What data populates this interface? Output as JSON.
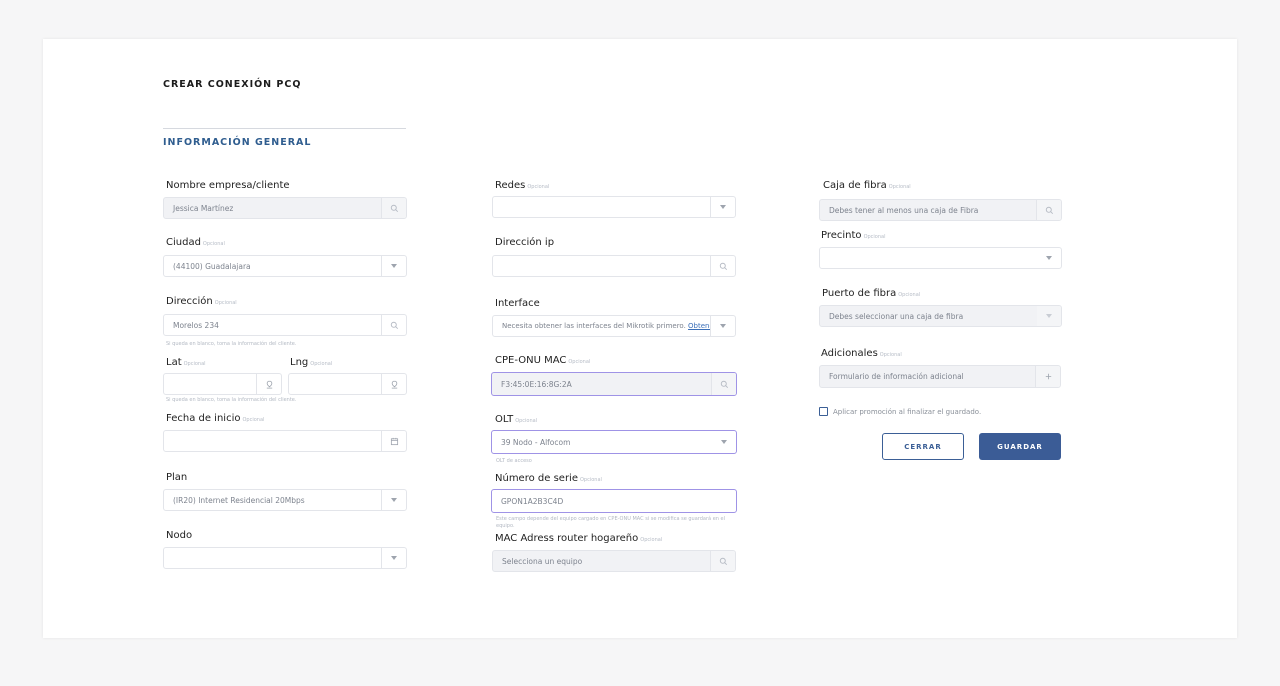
{
  "page": {
    "title": "CREAR CONEXIÓN PCQ",
    "section": "INFORMACIÓN GENERAL"
  },
  "optional_tag": "Opcional",
  "left": {
    "nombre": {
      "label": "Nombre empresa/cliente",
      "value": "Jessica Martínez"
    },
    "ciudad": {
      "label": "Ciudad",
      "value": "(44100) Guadalajara"
    },
    "direccion": {
      "label": "Dirección",
      "value": "Morelos 234",
      "help": "Si queda en blanco, toma la información del cliente."
    },
    "lat": {
      "label": "Lat",
      "value": ""
    },
    "lng": {
      "label": "Lng",
      "value": ""
    },
    "coords_help": "Si queda en blanco, toma la información del cliente.",
    "fecha": {
      "label": "Fecha de inicio",
      "value": ""
    },
    "plan": {
      "label": "Plan",
      "value": "(IR20) Internet Residencial 20Mbps"
    },
    "nodo": {
      "label": "Nodo",
      "value": ""
    }
  },
  "middle": {
    "redes": {
      "label": "Redes",
      "value": ""
    },
    "ip": {
      "label": "Dirección ip",
      "value": ""
    },
    "interface": {
      "label": "Interface",
      "value": "Necesita obtener las interfaces del Mikrotik primero.",
      "link": "Obtener"
    },
    "mac": {
      "label": "CPE-ONU MAC",
      "value": "F3:45:0E:16:8G:2A"
    },
    "olt": {
      "label": "OLT",
      "value": "39 Nodo - Alfocom",
      "help": "OLT de acceso"
    },
    "serie": {
      "label": "Número de serie",
      "value": "GPON1A2B3C4D",
      "help": "Este campo depende del equipo cargado en CPE-ONU MAC si se modifica se guardará en el equipo."
    },
    "router": {
      "label": "MAC Adress router hogareño",
      "placeholder": "Selecciona un equipo"
    }
  },
  "right": {
    "caja": {
      "label": "Caja de fibra",
      "placeholder": "Debes tener al menos una caja de Fibra"
    },
    "precinto": {
      "label": "Precinto",
      "value": ""
    },
    "puerto": {
      "label": "Puerto de fibra",
      "placeholder": "Debes seleccionar una caja de fibra"
    },
    "adicionales": {
      "label": "Adicionales",
      "placeholder": "Formulario de información adicional"
    },
    "promo_label": "Aplicar promoción al finalizar el guardado."
  },
  "buttons": {
    "cancel": "CERRAR",
    "save": "GUARDAR"
  },
  "colors": {
    "accent": "#3b5c96",
    "section_title": "#2f5d8f",
    "focus_border": "#9f93e6",
    "background": "#f6f6f7"
  },
  "icons": {
    "search": "search-icon",
    "caret": "chevron-down-icon",
    "pin": "map-pin-icon",
    "calendar": "calendar-icon",
    "plus": "plus-icon"
  }
}
